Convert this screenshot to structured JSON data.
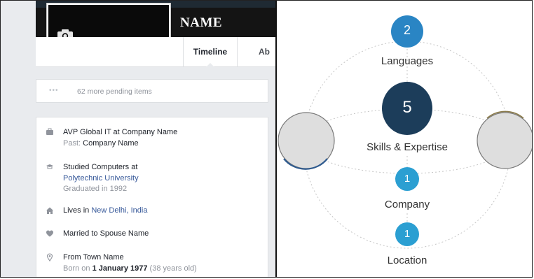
{
  "profile": {
    "name": "NAME",
    "tabs": [
      {
        "label": "Timeline",
        "active": true
      },
      {
        "label": "Ab",
        "active": false
      }
    ]
  },
  "pending": {
    "dots": "•••",
    "text": "62 more pending items"
  },
  "about": {
    "work": {
      "line1": "AVP Global IT at Company Name",
      "past_label": "Past:",
      "past_value": "Company Name"
    },
    "education": {
      "line1": "Studied Computers at",
      "school": "Polytechnic University",
      "graduated": "Graduated in 1992"
    },
    "lives": {
      "prefix": "Lives in",
      "place": "New Delhi, India"
    },
    "relationship": {
      "text": "Married to Spouse Name"
    },
    "from": {
      "text": "From Town Name",
      "born_prefix": "Born on",
      "born_date": "1 January 1977",
      "age": "(38 years old)"
    }
  },
  "network": {
    "nodes": [
      {
        "count": "2",
        "label": "Languages",
        "color": "#2a85c4"
      },
      {
        "count": "5",
        "label": "Skills & Expertise",
        "color": "#1c3d5a"
      },
      {
        "count": "1",
        "label": "Company",
        "color": "#2b9fd2"
      },
      {
        "count": "1",
        "label": "Location",
        "color": "#2b9fd2"
      }
    ],
    "side_circle_color": "#dedede"
  },
  "icons": [
    "camera-icon",
    "briefcase-icon",
    "graduation-cap-icon",
    "home-icon",
    "heart-icon",
    "location-pin-icon"
  ]
}
